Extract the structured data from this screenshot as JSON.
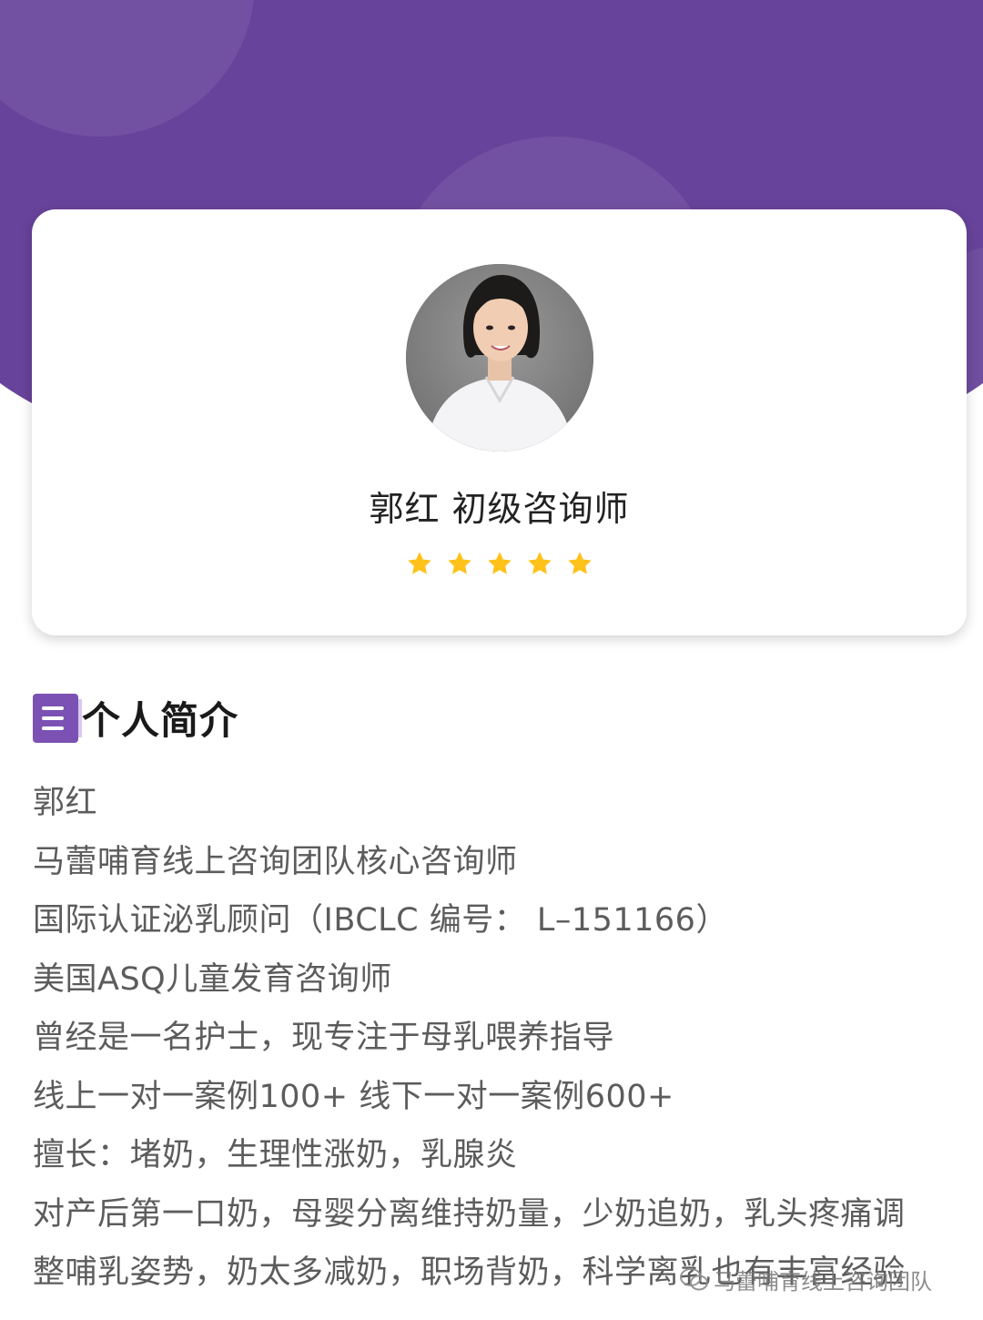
{
  "profile": {
    "name_title": "郭红  初级咨询师",
    "rating": {
      "value": 5,
      "max": 5
    },
    "star_color": "#ffc21a"
  },
  "section": {
    "icon": "document-icon",
    "title": "个人简介"
  },
  "bio_lines": [
    "郭红",
    "马蕾哺育线上咨询团队核心咨询师",
    "国际认证泌乳顾问（IBCLC 编号： L–151166）",
    "美国ASQ儿童发育咨询师",
    "曾经是一名护士，现专注于母乳喂养指导",
    "线上一对一案例100+ 线下一对一案例600+",
    "擅长：堵奶，生理性涨奶，乳腺炎",
    "对产后第一口奶，母婴分离维持奶量，少奶追奶，乳头疼痛调",
    "整哺乳姿势，奶太多减奶，职场背奶，科学离乳也有丰富经验"
  ],
  "watermark": {
    "icon": "wechat-icon",
    "text": "马蕾哺育线上咨询团队"
  },
  "colors": {
    "header_purple": "#68439b",
    "icon_purple": "#7b52b3"
  }
}
